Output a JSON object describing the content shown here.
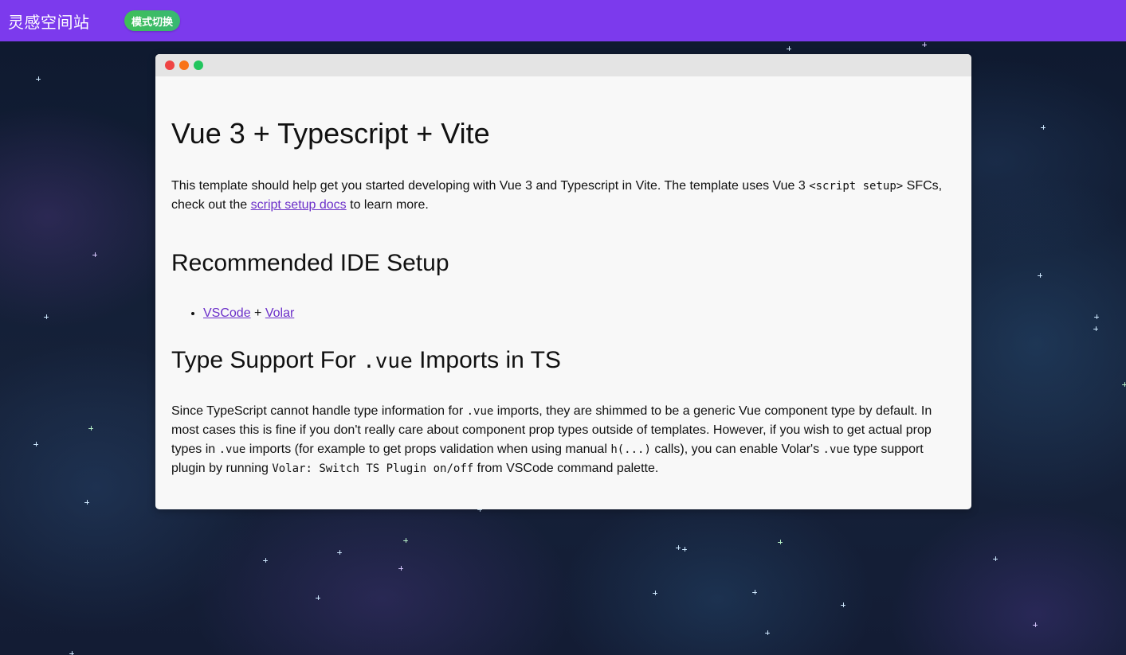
{
  "header": {
    "brand": "灵感空间站",
    "mode_button": "模式切换",
    "bg_color": "#7c3aed"
  },
  "window": {
    "dots": [
      "#ef4444",
      "#f97316",
      "#22c55e"
    ],
    "title": "Vue 3 + Typescript + Vite",
    "intro": {
      "t1": "This template should help get you started developing with Vue 3 and Typescript in Vite. The template uses Vue 3 ",
      "code1": "<script setup>",
      "t2": " SFCs, check out the ",
      "link": "script setup docs",
      "t3": " to learn more."
    },
    "ide_heading": "Recommended IDE Setup",
    "ide_items": {
      "vscode": "VSCode",
      "plus": " + ",
      "volar": "Volar"
    },
    "types_heading": {
      "pre": "Type Support For ",
      "code": ".vue",
      "post": " Imports in TS"
    },
    "types_body": {
      "t1": "Since TypeScript cannot handle type information for ",
      "c1": ".vue",
      "t2": " imports, they are shimmed to be a generic Vue component type by default. In most cases this is fine if you don't really care about component prop types outside of templates. However, if you wish to get actual prop types in ",
      "c2": ".vue",
      "t3": " imports (for example to get props validation when using manual ",
      "c3": "h(...)",
      "t4": " calls), you can enable Volar's ",
      "c4": ".vue",
      "t5": " type support plugin by running ",
      "c5": "Volar: Switch TS Plugin on/off",
      "t6": " from VSCode command palette."
    }
  }
}
